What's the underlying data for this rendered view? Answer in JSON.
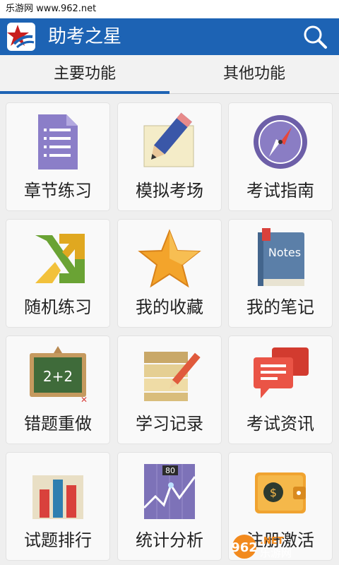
{
  "status_bar": {
    "watermark_text": "乐游网 www.962.net"
  },
  "app_bar": {
    "title": "助考之星",
    "search_icon": "search-icon"
  },
  "tabs": [
    {
      "label": "主要功能",
      "selected": true
    },
    {
      "label": "其他功能",
      "selected": false
    }
  ],
  "tiles": [
    {
      "label": "章节练习",
      "icon": "document-list-icon"
    },
    {
      "label": "模拟考场",
      "icon": "pencil-icon"
    },
    {
      "label": "考试指南",
      "icon": "compass-icon"
    },
    {
      "label": "随机练习",
      "icon": "shuffle-icon"
    },
    {
      "label": "我的收藏",
      "icon": "star-icon"
    },
    {
      "label": "我的笔记",
      "icon": "notes-book-icon",
      "icon_text": "Notes"
    },
    {
      "label": "错题重做",
      "icon": "chalkboard-icon",
      "icon_text": "2+2"
    },
    {
      "label": "学习记录",
      "icon": "notepad-pencil-icon"
    },
    {
      "label": "考试资讯",
      "icon": "chat-bubbles-icon"
    },
    {
      "label": "试题排行",
      "icon": "bar-chart-icon"
    },
    {
      "label": "统计分析",
      "icon": "line-chart-icon",
      "icon_text": "80"
    },
    {
      "label": "注册激活",
      "icon": "wallet-icon",
      "icon_text": "$"
    }
  ],
  "watermark": {
    "logo_text": "962",
    "net_text": ".NET",
    "cn_text": "乐游网"
  },
  "colors": {
    "app_bar": "#1d63b4",
    "accent": "#1d63b4",
    "background": "#efefef"
  }
}
